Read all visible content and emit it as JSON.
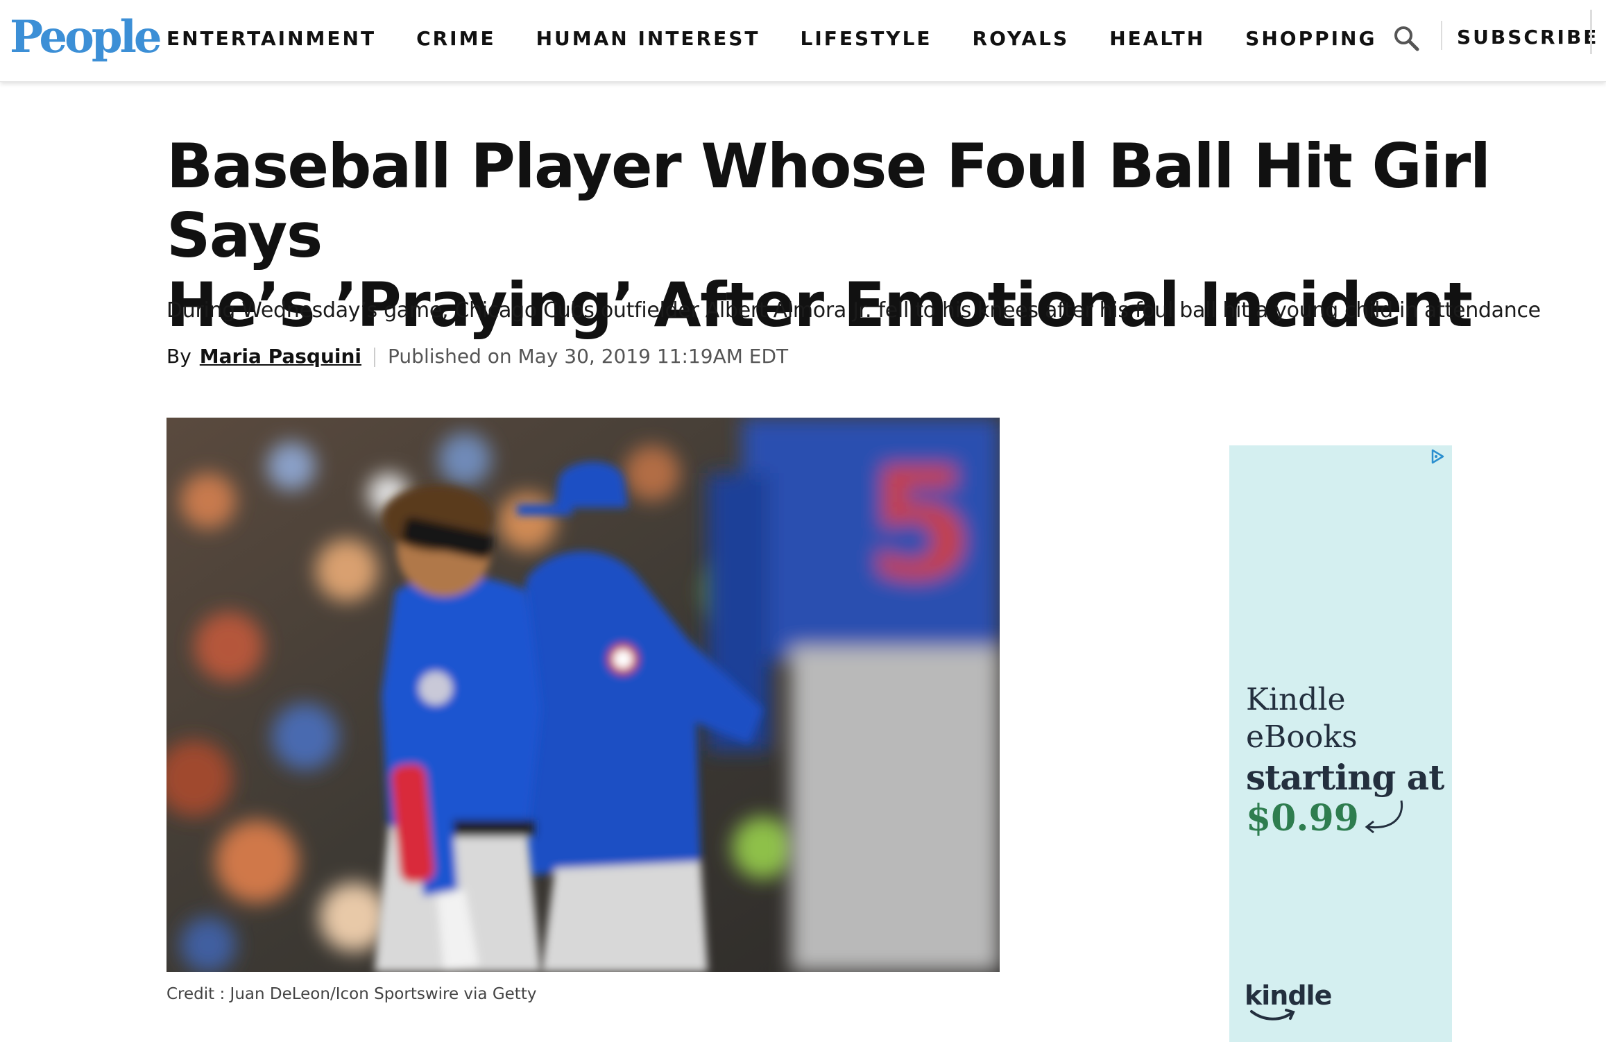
{
  "header": {
    "logo": "People",
    "nav": [
      "ENTERTAINMENT",
      "CRIME",
      "HUMAN INTEREST",
      "LIFESTYLE",
      "ROYALS",
      "HEALTH",
      "SHOPPING"
    ],
    "search_icon": "search-icon",
    "subscribe_label": "SUBSCRIBE"
  },
  "article": {
    "headline_line1": "Baseball Player Whose Foul Ball Hit Girl Says",
    "headline_line2": "He’s ’Praying’ After Emotional Incident",
    "dek": "During Wednesday’s game, Chicago Cubs outfielder Albert Almora Jr. fell to his knees after his foul ball hit a young child in attendance",
    "byline": {
      "by": "By",
      "author": "Maria Pasquini",
      "published": "Published on May 30, 2019 11:19AM EDT"
    },
    "photo_credit": "Credit : Juan DeLeon/Icon Sportswire via Getty"
  },
  "ad": {
    "adchoices_icon": "adchoices-icon",
    "line1": "Kindle",
    "line2": "eBooks",
    "line3": "starting at",
    "price": "$0.99",
    "brand": "kindle",
    "colors": {
      "background": "#d4eff0",
      "text": "#232f3e",
      "price": "#2e7d4f"
    }
  },
  "colors": {
    "logo": "#3c8fd6",
    "text": "#111111"
  }
}
